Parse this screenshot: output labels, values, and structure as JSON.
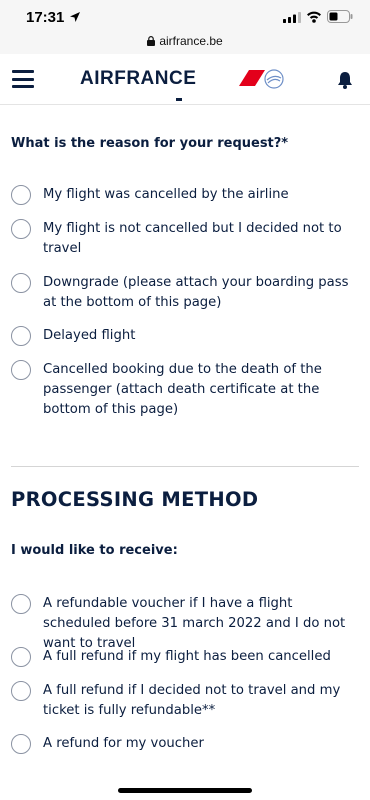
{
  "status_bar": {
    "time": "17:31"
  },
  "browser": {
    "url": "airfrance.be"
  },
  "header": {
    "brand": "AIRFRANCE"
  },
  "reason_section": {
    "question": "What is the reason for your request?*",
    "options": [
      {
        "label": "My flight was cancelled by the airline"
      },
      {
        "label": "My flight is not cancelled but I decided not to travel"
      },
      {
        "label": "Downgrade (please attach your boarding pass at the bottom of this page)"
      },
      {
        "label": "Delayed flight"
      },
      {
        "label": "Cancelled booking due to the death of the passenger (attach death certificate at the bottom of this page)"
      }
    ]
  },
  "processing_section": {
    "title": "PROCESSING METHOD",
    "question": "I would like to receive:",
    "options": [
      {
        "label": "A refundable voucher if I have a flight scheduled before 31 march 2022 and I do not want to travel"
      },
      {
        "label": "A full refund if my flight has been cancelled"
      },
      {
        "label": "A full refund if I decided not to travel and my ticket is fully refundable**"
      },
      {
        "label": "A refund for my voucher"
      }
    ]
  },
  "colors": {
    "navy": "#0b1e3f",
    "brand_red": "#e3001b",
    "radio_border": "#8b93a3"
  }
}
